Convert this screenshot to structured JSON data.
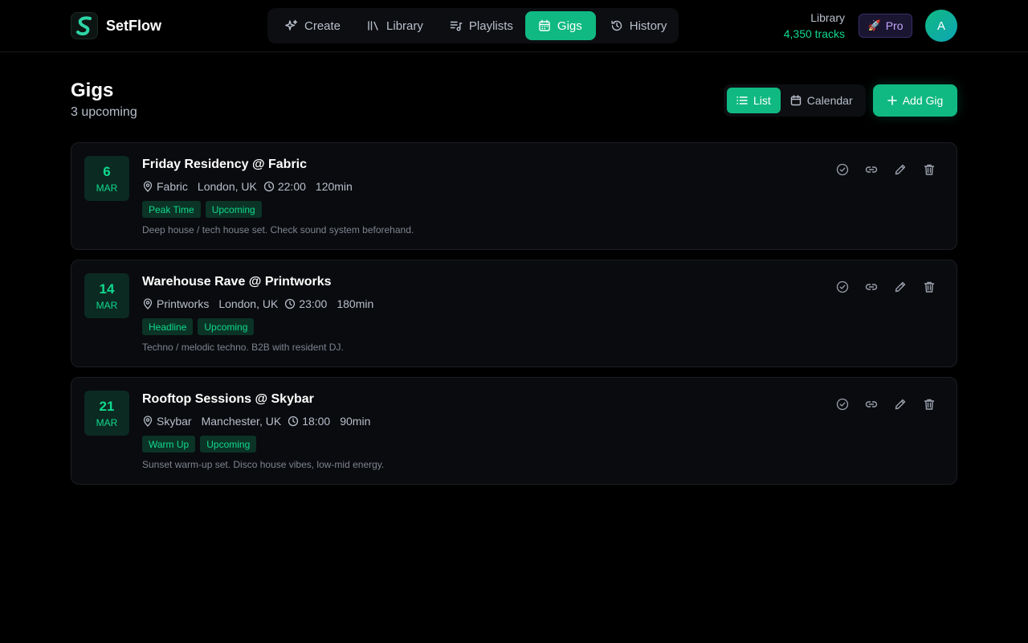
{
  "app": {
    "name": "SetFlow",
    "accent": "#10b981"
  },
  "nav": {
    "items": [
      {
        "label": "Create",
        "icon": "sparkles-icon"
      },
      {
        "label": "Library",
        "icon": "library-icon"
      },
      {
        "label": "Playlists",
        "icon": "playlist-icon"
      },
      {
        "label": "Gigs",
        "icon": "calendar-icon",
        "active": true
      },
      {
        "label": "History",
        "icon": "history-icon"
      }
    ]
  },
  "header": {
    "library_label": "Library",
    "library_count": "4,350 tracks",
    "pro_label": "Pro",
    "avatar_initial": "A"
  },
  "page": {
    "title": "Gigs",
    "subtitle": "3 upcoming",
    "view_list": "List",
    "view_calendar": "Calendar",
    "add_label": "Add Gig"
  },
  "gigs": [
    {
      "day": "6",
      "month": "MAR",
      "title": "Friday Residency @ Fabric",
      "venue": "Fabric",
      "location": "London, UK",
      "time": "22:00",
      "duration": "120min",
      "tags": [
        "Peak Time",
        "Upcoming"
      ],
      "notes": "Deep house / tech house set. Check sound system beforehand."
    },
    {
      "day": "14",
      "month": "MAR",
      "title": "Warehouse Rave @ Printworks",
      "venue": "Printworks",
      "location": "London, UK",
      "time": "23:00",
      "duration": "180min",
      "tags": [
        "Headline",
        "Upcoming"
      ],
      "notes": "Techno / melodic techno. B2B with resident DJ."
    },
    {
      "day": "21",
      "month": "MAR",
      "title": "Rooftop Sessions @ Skybar",
      "venue": "Skybar",
      "location": "Manchester, UK",
      "time": "18:00",
      "duration": "90min",
      "tags": [
        "Warm Up",
        "Upcoming"
      ],
      "notes": "Sunset warm-up set. Disco house vibes, low-mid energy."
    }
  ]
}
